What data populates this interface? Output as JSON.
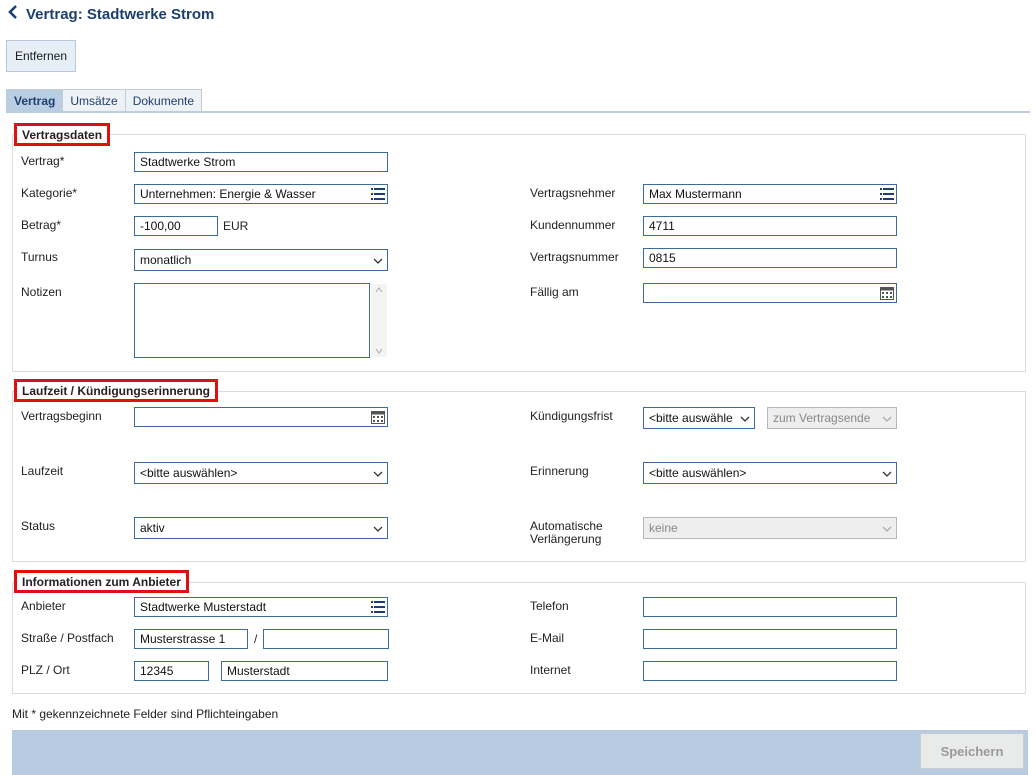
{
  "header": {
    "back_icon": "chevron-left-icon",
    "title": "Vertrag: Stadtwerke Strom"
  },
  "toolbar": {
    "remove_label": "Entfernen"
  },
  "tabs": [
    {
      "label": "Vertrag",
      "active": true
    },
    {
      "label": "Umsätze",
      "active": false
    },
    {
      "label": "Dokumente",
      "active": false
    }
  ],
  "vertragsdaten": {
    "legend": "Vertragsdaten",
    "vertrag_label": "Vertrag*",
    "vertrag_value": "Stadtwerke Strom",
    "kategorie_label": "Kategorie*",
    "kategorie_value": "Unternehmen: Energie & Wasser",
    "betrag_label": "Betrag*",
    "betrag_value": "-100,00",
    "betrag_currency": "EUR",
    "turnus_label": "Turnus",
    "turnus_value": "monatlich",
    "notizen_label": "Notizen",
    "notizen_value": "",
    "vertragsnehmer_label": "Vertragsnehmer",
    "vertragsnehmer_value": "Max Mustermann",
    "kundennummer_label": "Kundennummer",
    "kundennummer_value": "4711",
    "vertragsnummer_label": "Vertragsnummer",
    "vertragsnummer_value": "0815",
    "faellig_label": "Fällig am",
    "faellig_value": ""
  },
  "laufzeit": {
    "legend": "Laufzeit / Kündigungserinnerung",
    "vertragsbeginn_label": "Vertragsbeginn",
    "vertragsbeginn_value": "",
    "laufzeit_label": "Laufzeit",
    "laufzeit_value": "<bitte auswählen>",
    "status_label": "Status",
    "status_value": "aktiv",
    "kuendigungsfrist_label": "Kündigungsfrist",
    "kuendigungsfrist_value": "<bitte auswähle",
    "kuendigungsfrist_bezug_value": "zum Vertragsende",
    "erinnerung_label": "Erinnerung",
    "erinnerung_value": "<bitte auswählen>",
    "verlaengerung_label_1": "Automatische",
    "verlaengerung_label_2": "Verlängerung",
    "verlaengerung_value": "keine"
  },
  "anbieter": {
    "legend": "Informationen zum Anbieter",
    "anbieter_label": "Anbieter",
    "anbieter_value": "Stadtwerke Musterstadt",
    "strasse_label": "Straße / Postfach",
    "strasse_value": "Musterstrasse 1",
    "strasse_sep": "/",
    "postfach_value": "",
    "plzort_label": "PLZ / Ort",
    "plz_value": "12345",
    "ort_value": "Musterstadt",
    "telefon_label": "Telefon",
    "telefon_value": "",
    "email_label": "E-Mail",
    "email_value": "",
    "internet_label": "Internet",
    "internet_value": ""
  },
  "footer": {
    "note": "Mit * gekennzeichnete Felder sind Pflichteingaben",
    "save_label": "Speichern"
  },
  "colors": {
    "accent": "#1d3f6e",
    "input_border": "#3a6aa0",
    "legend_highlight": "#e01010",
    "footer_bar": "#b9cbe0"
  }
}
